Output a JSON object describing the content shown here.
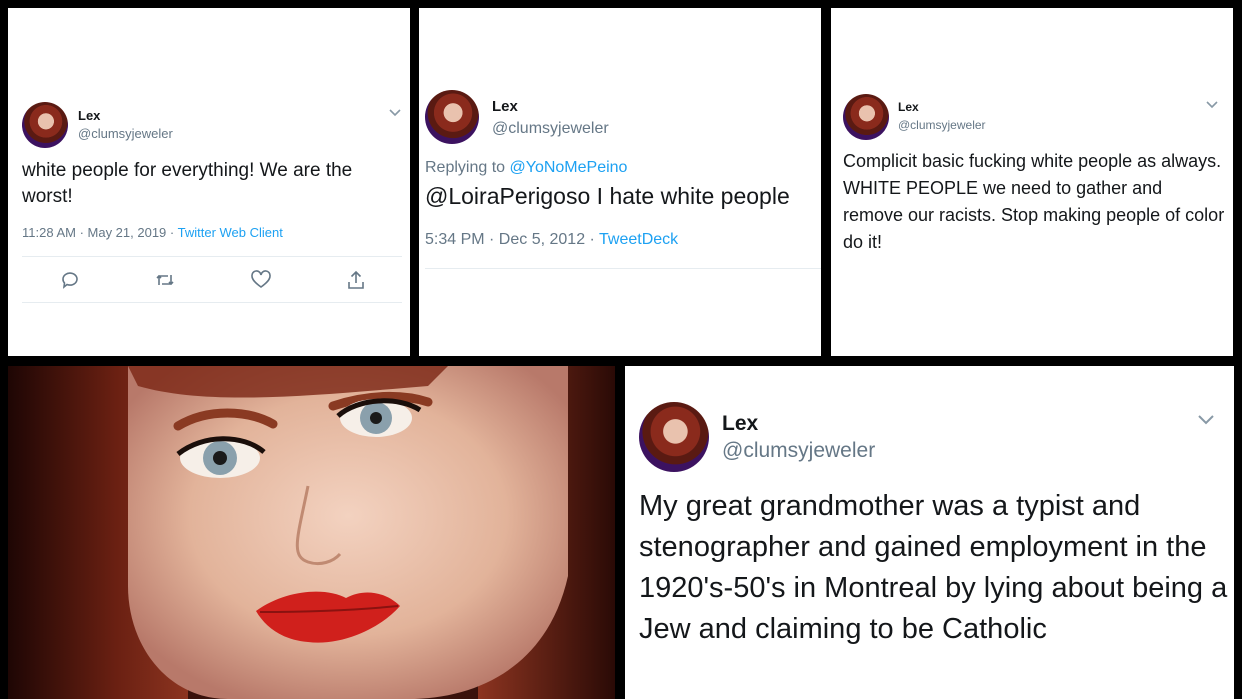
{
  "tweet1": {
    "name": "Lex",
    "handle": "@clumsyjeweler",
    "text": "white people for everything! We are the worst!",
    "time": "11:28 AM · May 21, 2019 · ",
    "client": "Twitter Web Client"
  },
  "tweet2": {
    "name": "Lex",
    "handle": "@clumsyjeweler",
    "replying_label": "Replying to ",
    "replying_to": "@YoNoMePeino",
    "text": "@LoiraPerigoso I hate white people",
    "time": "5:34 PM · Dec 5, 2012 · ",
    "client": "TweetDeck"
  },
  "tweet3": {
    "name": "Lex",
    "handle": "@clumsyjeweler",
    "text": "Complicit basic fucking white people as always. WHITE PEOPLE we need to gather and remove our racists. Stop making people of color do it!"
  },
  "tweet4": {
    "name": "Lex",
    "handle": "@clumsyjeweler",
    "text": "My great grandmother was a typist and stenographer and gained employment in the 1920's-50's in Montreal by lying about being a Jew and claiming to be Catholic"
  },
  "icons": {
    "reply": "reply-icon",
    "retweet": "retweet-icon",
    "like": "like-icon",
    "share": "share-icon",
    "chevron": "chevron-down-icon"
  },
  "colors": {
    "link": "#1da1f2",
    "secondary_text": "#657786",
    "primary_text": "#14171a"
  }
}
